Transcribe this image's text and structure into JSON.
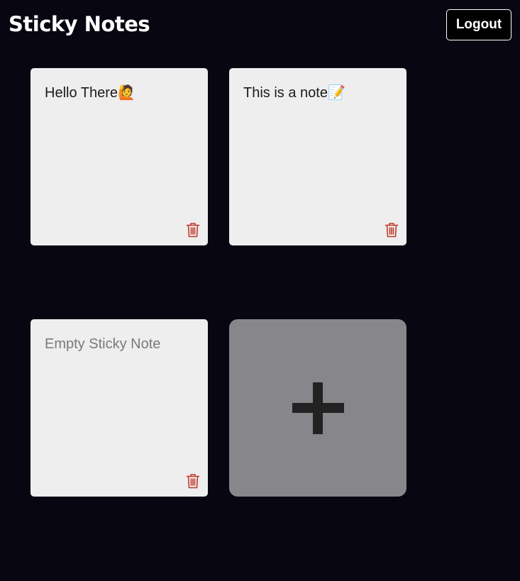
{
  "header": {
    "title": "Sticky Notes",
    "logout_label": "Logout"
  },
  "notes": [
    {
      "text": "Hello There🙋",
      "placeholder": "Empty Sticky Note",
      "delete_icon": "trash-icon"
    },
    {
      "text": "This is a note📝",
      "placeholder": "Empty Sticky Note",
      "delete_icon": "trash-icon"
    },
    {
      "text": "",
      "placeholder": "Empty Sticky Note",
      "delete_icon": "trash-icon"
    }
  ],
  "add_note": {
    "icon": "plus-icon"
  },
  "colors": {
    "background": "#080711",
    "note": "#eeeeee",
    "add_card": "#87868b",
    "delete": "#c0392b"
  }
}
